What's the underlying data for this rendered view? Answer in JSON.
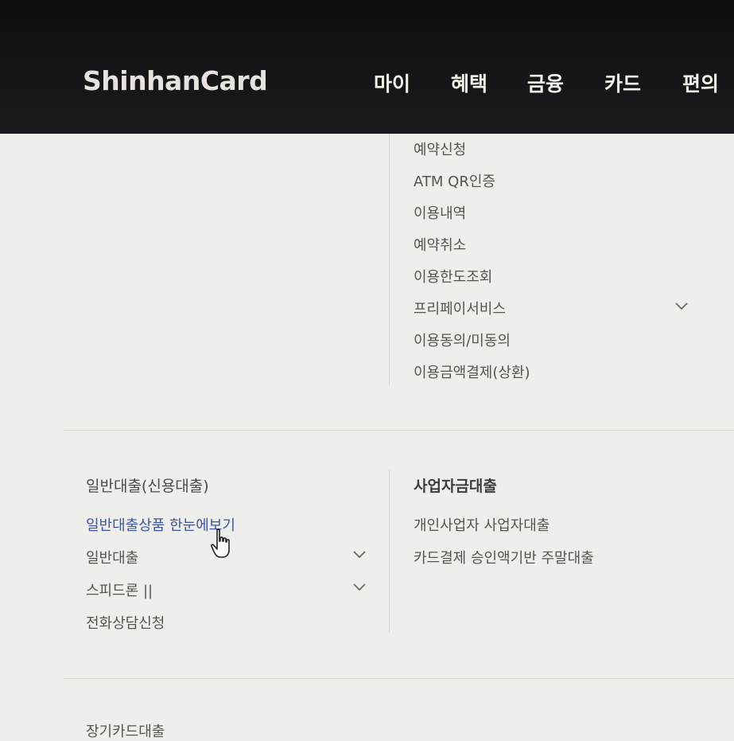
{
  "brand": {
    "logo_text": "ShinhanCard"
  },
  "gnb": {
    "items": [
      "마이",
      "혜택",
      "금융",
      "카드",
      "편의"
    ]
  },
  "upper_menu": {
    "items": [
      "예약신청",
      "ATM QR인증",
      "이용내역",
      "예약취소",
      "이용한도조회",
      "프리페이서비스",
      "이용동의/미동의",
      "이용금액결제(상환)"
    ]
  },
  "general_loan": {
    "title": "일반대출(신용대출)",
    "items": [
      "일반대출상품 한눈에보기",
      "일반대출",
      "스피드론 ||",
      "전화상담신청"
    ]
  },
  "business_loan": {
    "title": "사업자금대출",
    "items": [
      "개인사업자 사업자대출",
      "카드결제 승인액기반 주말대출"
    ]
  },
  "next_section": {
    "title_partial": "장기카드대출"
  },
  "icons": {
    "chevron": "chevron-down-icon",
    "cursor": "hand-pointer-icon"
  },
  "colors": {
    "header_bg": "#141416",
    "panel_bg": "#eeeeeb",
    "link_active": "#3c54a8",
    "text": "#55544f"
  }
}
